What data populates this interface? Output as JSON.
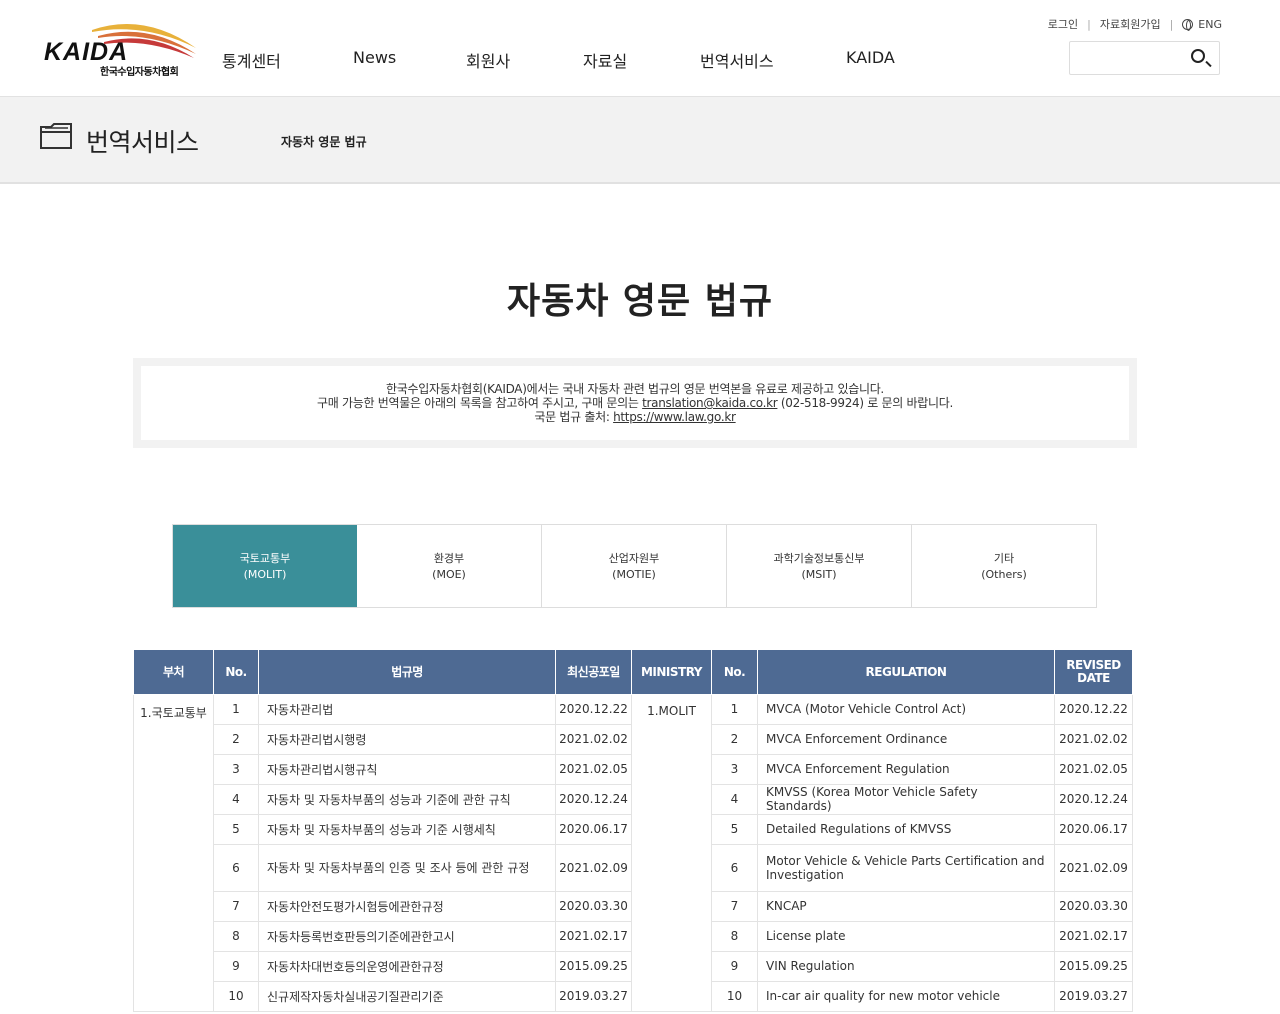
{
  "header": {
    "logo_text": "KAIDA",
    "logo_sub": "한국수입자동차협회",
    "nav": [
      "통계센터",
      "News",
      "회원사",
      "자료실",
      "번역서비스",
      "KAIDA"
    ],
    "util": {
      "login": "로그인",
      "signup": "자료회원가입",
      "lang": "ENG"
    },
    "search_placeholder": ""
  },
  "subbar": {
    "section": "번역서비스",
    "breadcrumb": "자동차 영문 법규"
  },
  "page_title": "자동차 영문 법규",
  "notice": {
    "line1": "한국수입자동차협회(KAIDA)에서는 국내 자동차 관련 법규의 영문 번역본을 유료로 제공하고 있습니다.",
    "line2_pre": "구매 가능한 번역물은 아래의 목록을 참고하여 주시고, 구매 문의는 ",
    "line2_email": "translation@kaida.co.kr",
    "line2_post": " (02-518-9924) 로 문의 바랍니다.",
    "line3_pre": "국문 법규 출처: ",
    "line3_link": "https://www.law.go.kr"
  },
  "tabs": [
    {
      "ko": "국토교통부",
      "en": "(MOLIT)"
    },
    {
      "ko": "환경부",
      "en": "(MOE)"
    },
    {
      "ko": "산업자원부",
      "en": "(MOTIE)"
    },
    {
      "ko": "과학기술정보통신부",
      "en": "(MSIT)"
    },
    {
      "ko": "기타",
      "en": "(Others)"
    }
  ],
  "table": {
    "headers": [
      "부처",
      "No.",
      "법규명",
      "최신공포일",
      "MINISTRY",
      "No.",
      "REGULATION",
      "REVISED",
      "DATE"
    ],
    "dept_ko": "1.국토교통부",
    "dept_en": "1.MOLIT",
    "rows": [
      {
        "no": "1",
        "ko": "자동차관리법",
        "date": "2020.12.22",
        "en": "MVCA (Motor Vehicle Control Act)"
      },
      {
        "no": "2",
        "ko": "자동차관리법시행령",
        "date": "2021.02.02",
        "en": "MVCA Enforcement Ordinance"
      },
      {
        "no": "3",
        "ko": "자동차관리법시행규칙",
        "date": "2021.02.05",
        "en": "MVCA Enforcement Regulation"
      },
      {
        "no": "4",
        "ko": "자동차 및 자동차부품의 성능과 기준에 관한 규칙",
        "date": "2020.12.24",
        "en": "KMVSS (Korea Motor Vehicle Safety Standards)"
      },
      {
        "no": "5",
        "ko": "자동차 및 자동차부품의 성능과 기준 시행세칙",
        "date": "2020.06.17",
        "en": "Detailed Regulations of KMVSS"
      },
      {
        "no": "6",
        "ko": "자동차 및 자동차부품의 인증 및 조사 등에 관한 규정",
        "date": "2021.02.09",
        "en": "Motor Vehicle & Vehicle Parts Certification and Investigation"
      },
      {
        "no": "7",
        "ko": "자동차안전도평가시험등에관한규정",
        "date": "2020.03.30",
        "en": "KNCAP"
      },
      {
        "no": "8",
        "ko": "자동차등록번호판등의기준에관한고시",
        "date": "2021.02.17",
        "en": "License plate"
      },
      {
        "no": "9",
        "ko": "자동차차대번호등의운영에관한규정",
        "date": "2015.09.25",
        "en": "VIN Regulation"
      },
      {
        "no": "10",
        "ko": "신규제작자동차실내공기질관리기준",
        "date": "2019.03.27",
        "en": "In-car air quality for new motor vehicle"
      }
    ]
  },
  "colors": {
    "accent": "#3a8f99",
    "table_header": "#4e6a93"
  }
}
